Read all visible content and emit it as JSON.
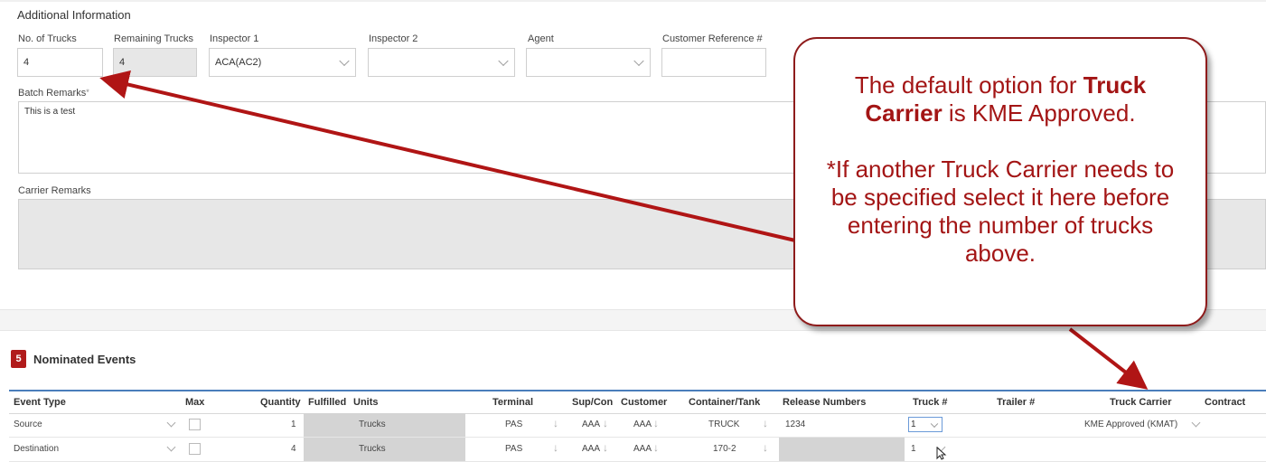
{
  "additional_info": {
    "section_title": "Additional Information",
    "no_of_trucks": {
      "label": "No. of Trucks",
      "value": "4"
    },
    "remaining_trucks": {
      "label": "Remaining Trucks",
      "value": "4"
    },
    "inspector1": {
      "label": "Inspector 1",
      "value": "ACA(AC2)"
    },
    "inspector2": {
      "label": "Inspector 2",
      "value": ""
    },
    "agent": {
      "label": "Agent",
      "value": ""
    },
    "customer_ref": {
      "label": "Customer Reference #",
      "value": ""
    },
    "batch_remarks": {
      "label": "Batch Remarks",
      "required_mark": "*",
      "value": "This is a test"
    },
    "carrier_remarks": {
      "label": "Carrier Remarks",
      "value": ""
    }
  },
  "nominated_events": {
    "badge": "5",
    "title": "Nominated Events",
    "columns": [
      "Event Type",
      "Max",
      "Quantity",
      "Fulfilled",
      "Units",
      "Terminal",
      "Sup/Con",
      "Customer",
      "Container/Tank",
      "Release Numbers",
      "Truck #",
      "Trailer #",
      "Truck Carrier",
      "Contract"
    ],
    "rows": [
      {
        "event_type": "Source",
        "quantity": "1",
        "units": "Trucks",
        "terminal": "PAS",
        "sup_con": "AAA",
        "customer": "AAA",
        "container": "TRUCK",
        "release": "1234",
        "truck_no": "1",
        "truck_carrier": "KME Approved (KMAT)"
      },
      {
        "event_type": "Destination",
        "quantity": "4",
        "units": "Trucks",
        "terminal": "PAS",
        "sup_con": "AAA",
        "customer": "AAA",
        "container": "170-2",
        "release": "",
        "truck_no": "1",
        "truck_carrier": ""
      }
    ]
  },
  "callout": {
    "line1_a": "The default option for ",
    "line1_b": "Truck",
    "line2_a": "Carrier",
    "line2_b": " is KME Approved.",
    "note": "*If another Truck Carrier needs to be specified select it here before entering the number of trucks above."
  },
  "colors": {
    "accent_red": "#a31515",
    "grid_header_line": "#4a7ebb"
  },
  "icons": [
    "chevron-down-icon",
    "sort-down-arrow-icon",
    "mouse-cursor-icon"
  ]
}
